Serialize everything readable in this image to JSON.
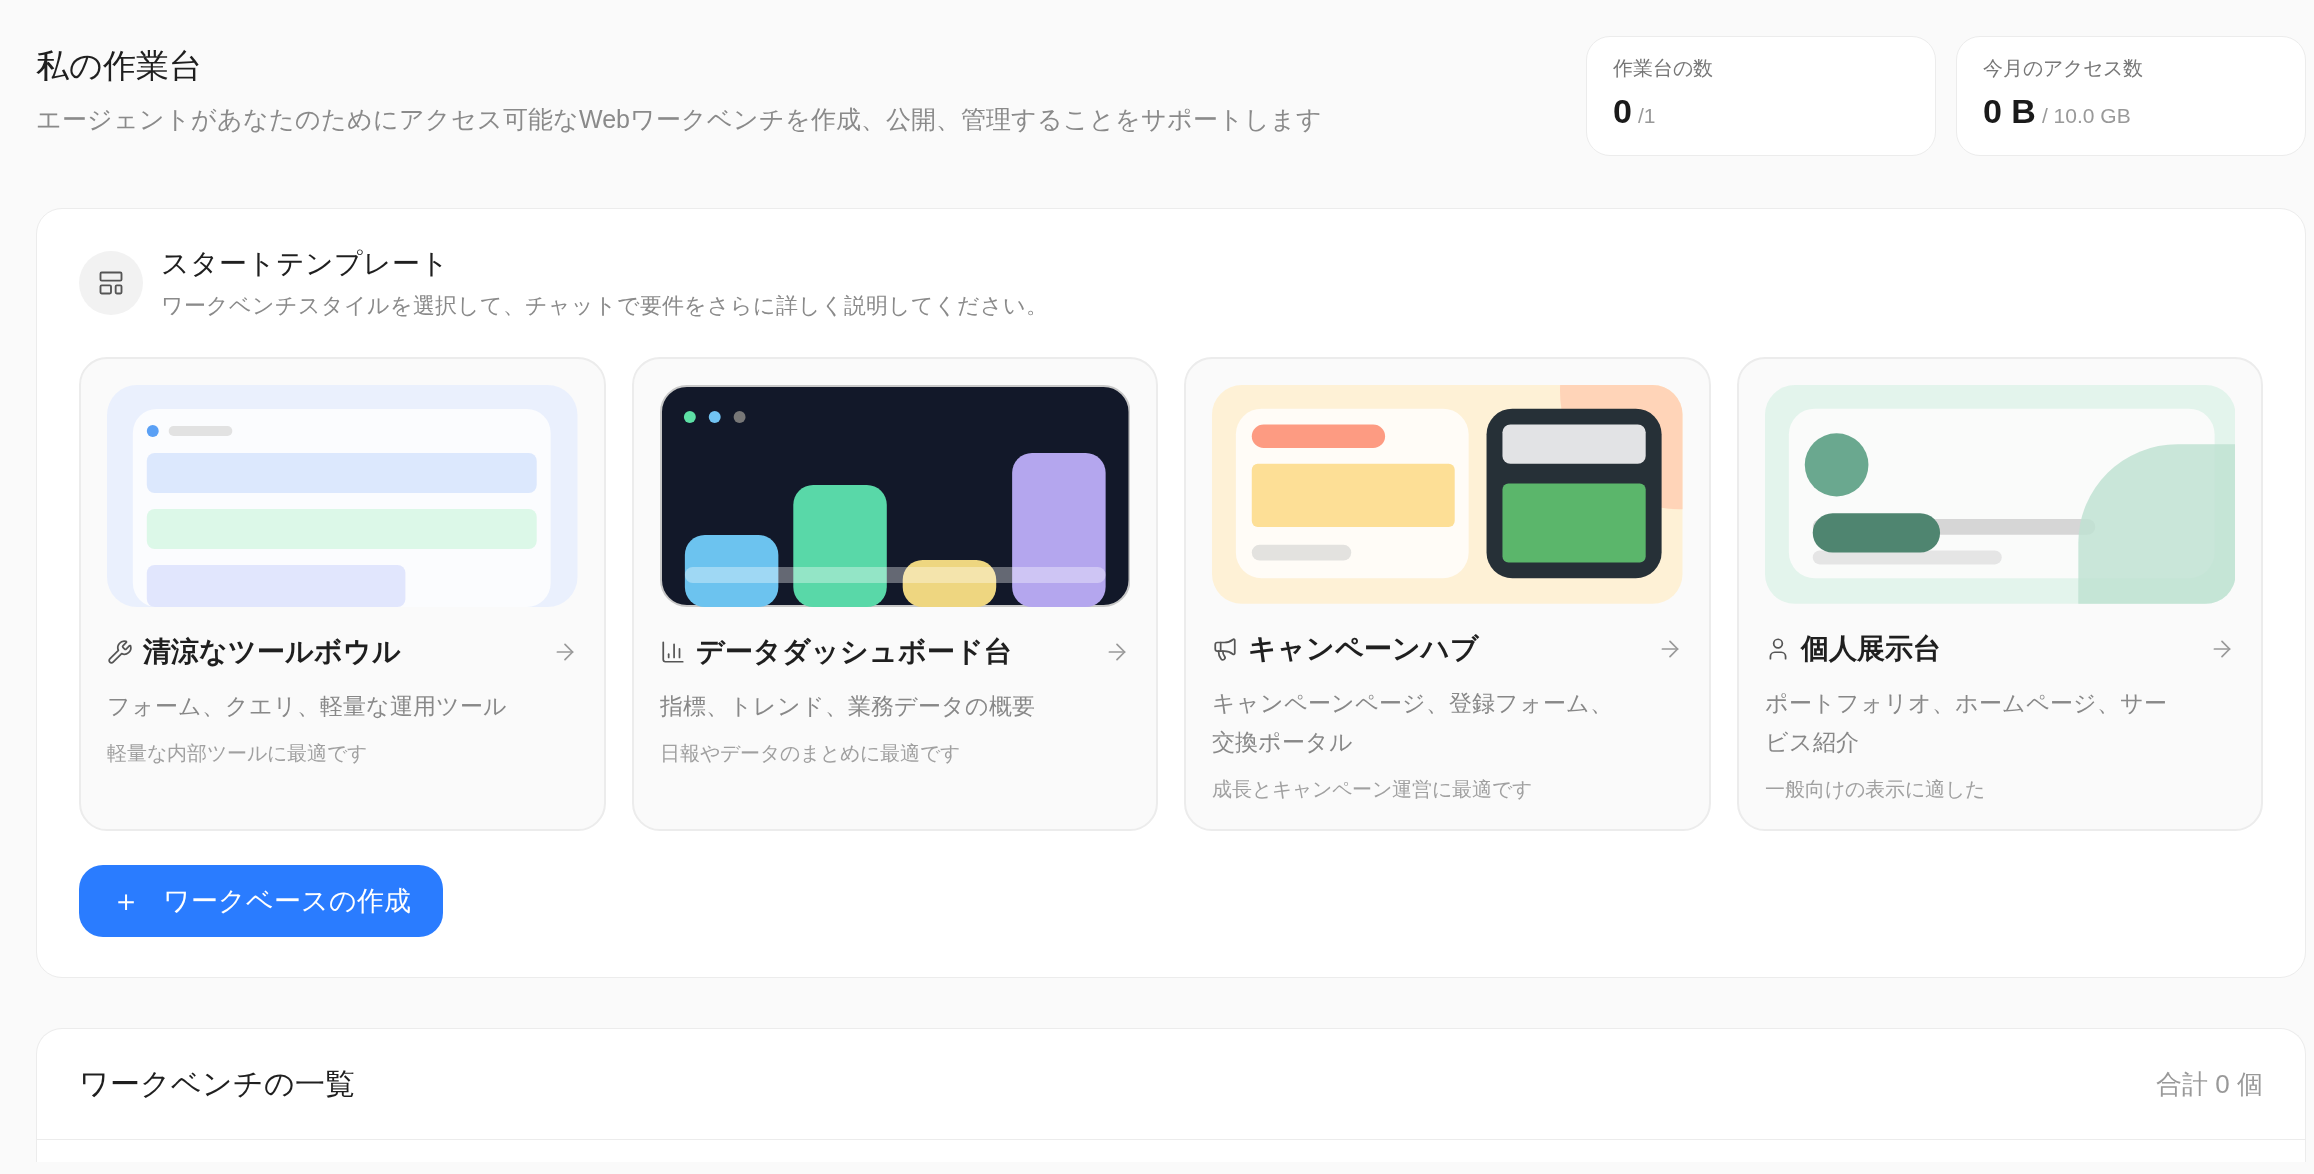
{
  "header": {
    "title": "私の作業台",
    "subtitle": "エージェントがあなたのためにアクセス可能なWebワークベンチを作成、公開、管理することをサポートします"
  },
  "stats": [
    {
      "label": "作業台の数",
      "value": "0",
      "total": "/1"
    },
    {
      "label": "今月のアクセス数",
      "value": "0 B",
      "total": "/ 10.0 GB"
    }
  ],
  "templates": {
    "title": "スタートテンプレート",
    "subtitle": "ワークベンチスタイルを選択して、チャットで要件をさらに詳しく説明してください。",
    "cards": [
      {
        "kind": "tools",
        "title": "清涼なツールボウル",
        "description": "フォーム、クエリ、軽量な運用ツール",
        "note": "軽量な内部ツールに最適です"
      },
      {
        "kind": "dashboard",
        "title": "データダッシュボード台",
        "description": "指標、トレンド、業務データの概要",
        "note": "日報やデータのまとめに最適です"
      },
      {
        "kind": "campaign",
        "title": "キャンペーンハブ",
        "description": "キャンペーンページ、登録フォーム、交換ポータル",
        "note": "成長とキャンペーン運営に最適です"
      },
      {
        "kind": "personal",
        "title": "個人展示台",
        "description": "ポートフォリオ、ホームページ、サービス紹介",
        "note": "一般向けの表示に適した"
      }
    ],
    "create_button": {
      "icon": "＋",
      "label": "ワークベースの作成"
    }
  },
  "list": {
    "title": "ワークベンチの一覧",
    "total": "合計 0 個"
  }
}
